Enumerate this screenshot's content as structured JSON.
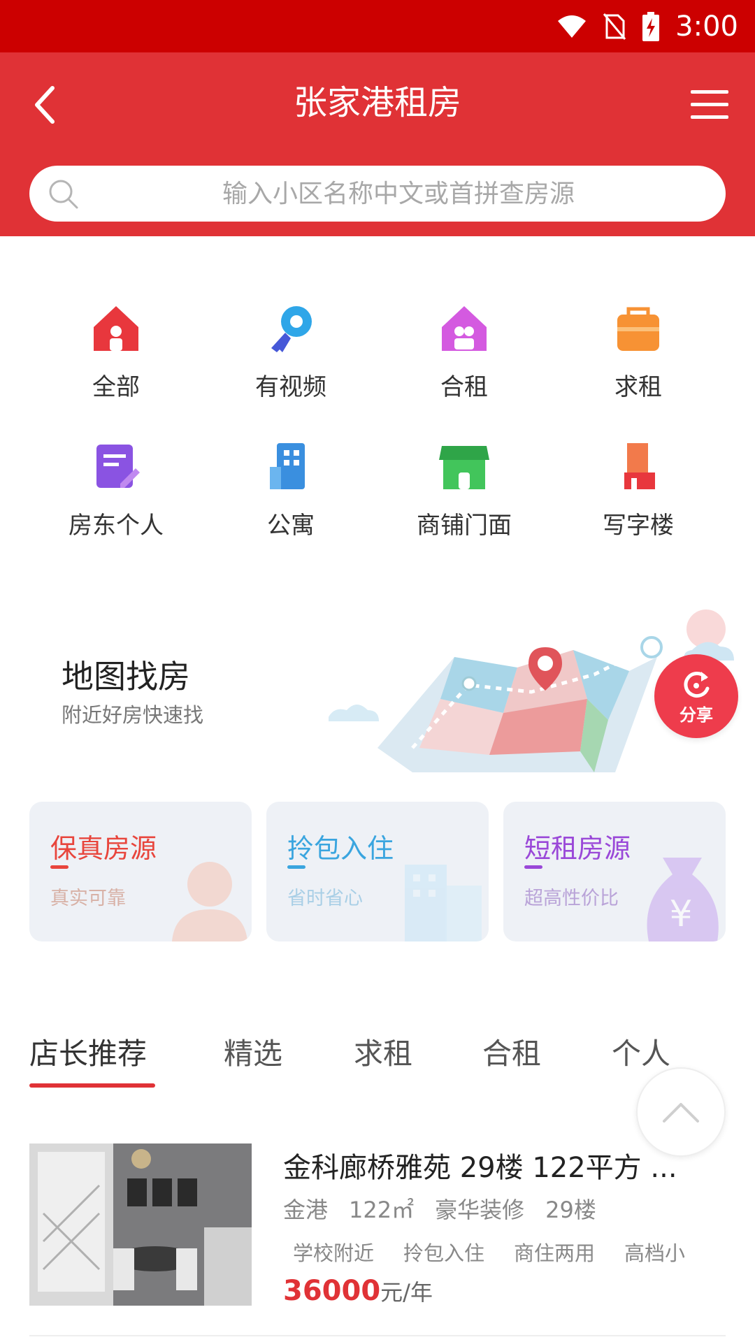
{
  "status_bar": {
    "time": "3:00",
    "icons": [
      "wifi-icon",
      "no-sim-icon",
      "battery-charging-icon"
    ]
  },
  "header": {
    "title": "张家港租房",
    "back_icon": "chevron-left-icon",
    "menu_icon": "menu-icon",
    "bg_color": "#e03236"
  },
  "search": {
    "placeholder": "输入小区名称中文或首拼查房源",
    "icon": "search-icon"
  },
  "categories": [
    {
      "label": "全部",
      "icon": "house-icon",
      "color": "#e8373d"
    },
    {
      "label": "有视频",
      "icon": "key-icon",
      "color": "#2fa6e8"
    },
    {
      "label": "合租",
      "icon": "shared-house-icon",
      "color": "#d45ae0"
    },
    {
      "label": "求租",
      "icon": "bag-icon",
      "color": "#f79234"
    },
    {
      "label": "房东个人",
      "icon": "document-icon",
      "color": "#8a53e2"
    },
    {
      "label": "公寓",
      "icon": "apartment-icon",
      "color": "#3a8fdf"
    },
    {
      "label": "商铺门面",
      "icon": "shop-icon",
      "color": "#42c55b"
    },
    {
      "label": "写字楼",
      "icon": "office-building-icon",
      "color": "#e8503d"
    }
  ],
  "map_banner": {
    "title": "地图找房",
    "subtitle": "附近好房快速找"
  },
  "share": {
    "label": "分享",
    "icon": "refresh-icon"
  },
  "feature_cards": [
    {
      "title": "保真房源",
      "subtitle": "真实可靠",
      "color": "#e8453c",
      "sub_color": "#d8b1a6",
      "icon": "person-icon"
    },
    {
      "title": "拎包入住",
      "subtitle": "省时省心",
      "color": "#3aa5df",
      "sub_color": "#a9cfe6",
      "icon": "building-icon"
    },
    {
      "title": "短租房源",
      "subtitle": "超高性价比",
      "color": "#9a48d8",
      "sub_color": "#b9a3d8",
      "icon": "money-bag-icon"
    }
  ],
  "tabs": [
    {
      "label": "店长推荐",
      "active": true
    },
    {
      "label": "精选",
      "active": false
    },
    {
      "label": "求租",
      "active": false
    },
    {
      "label": "合租",
      "active": false
    },
    {
      "label": "个人",
      "active": false
    }
  ],
  "scroll_top_icon": "chevron-up-icon",
  "listing": {
    "title": "金科廊桥雅苑 29楼 122平方 ...",
    "area_name": "金港",
    "size": "122㎡",
    "decoration": "豪华装修",
    "floor": "29楼",
    "tags": [
      "学校附近",
      "拎包入住",
      "商住两用",
      "高档小"
    ],
    "price": "36000",
    "price_unit": "元/年"
  }
}
